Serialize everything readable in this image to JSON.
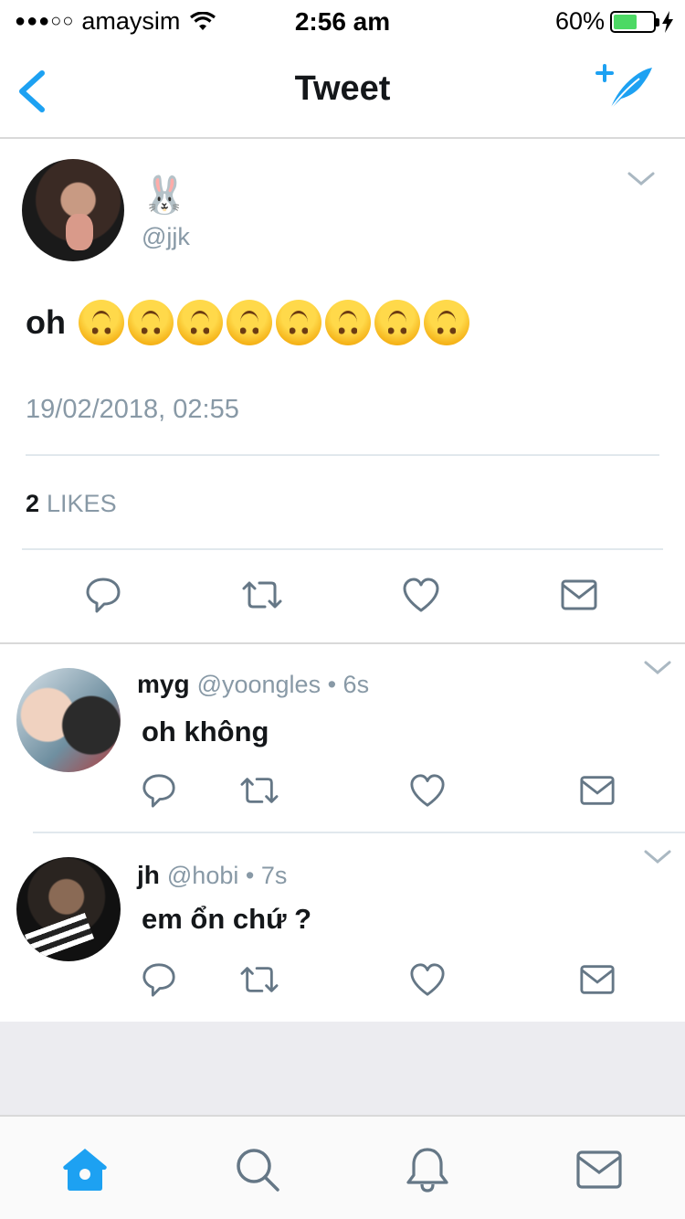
{
  "status_bar": {
    "signal": "●●●○○",
    "carrier": "amaysim",
    "time": "2:56 am",
    "battery_percent": "60%",
    "battery_level": 0.6
  },
  "nav": {
    "title": "Tweet"
  },
  "main_tweet": {
    "name": "🐰",
    "handle": "@jjk",
    "text": "oh",
    "emoji_count": 8,
    "timestamp": "19/02/2018, 02:55",
    "likes_count": "2",
    "likes_label": "LIKES"
  },
  "replies": [
    {
      "name": "myg",
      "handle": "@yoongles",
      "time": "• 6s",
      "text": "oh không"
    },
    {
      "name": "jh",
      "handle": "@hobi",
      "time": "• 7s",
      "text": "em ổn chứ ?"
    }
  ],
  "colors": {
    "accent": "#1da1f2",
    "icon_gray": "#657786",
    "secondary_text": "#8899a6",
    "battery": "#4cd964"
  },
  "icons": {
    "back": "chevron-left-icon",
    "compose": "compose-feather-icon",
    "reply": "reply-icon",
    "retweet": "retweet-icon",
    "like": "heart-icon",
    "dm": "envelope-icon",
    "home": "home-icon",
    "search": "search-icon",
    "notifications": "bell-icon",
    "messages": "envelope-icon"
  }
}
